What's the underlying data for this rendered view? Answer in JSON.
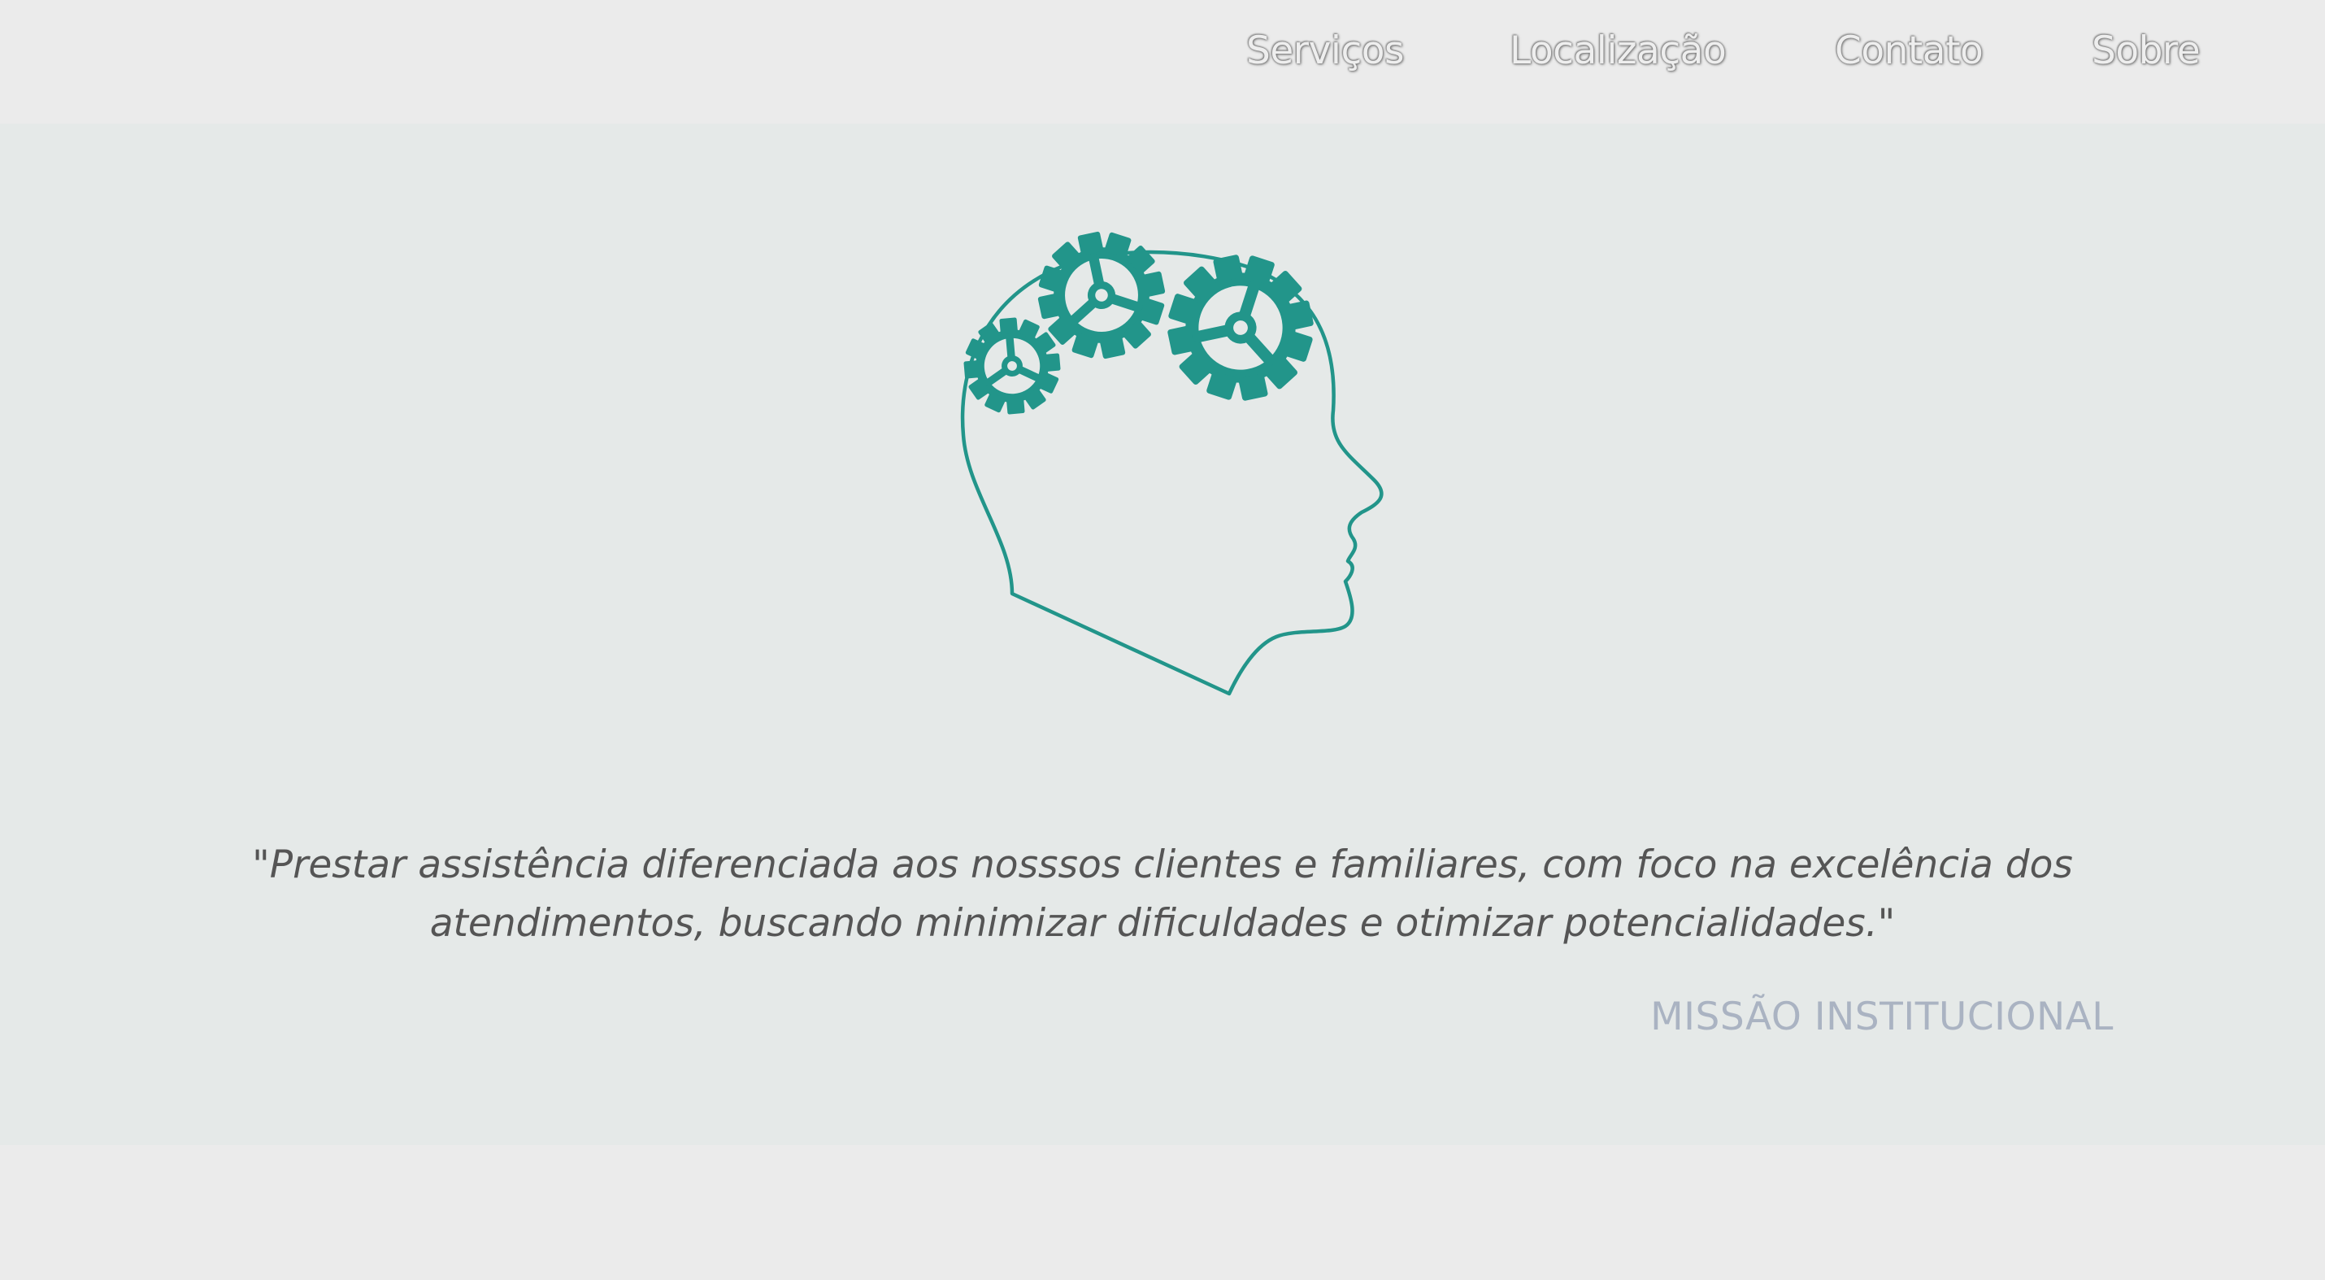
{
  "nav": {
    "items": [
      {
        "label": "Serviços"
      },
      {
        "label": "Localização"
      },
      {
        "label": "Contato"
      },
      {
        "label": "Sobre"
      }
    ]
  },
  "hero": {
    "logo_icon": "head-with-gears-icon",
    "quote_line1": "\"Prestar assistência diferenciada aos nosssos clientes e familiares, com foco na excelência dos",
    "quote_line2": "atendimentos, buscando minimizar dificuldades e otimizar potencialidades.\"",
    "mission_label": "MISSÃO INSTITUCIONAL"
  },
  "colors": {
    "accent": "#22958a",
    "page_bg": "#ebebeb",
    "hero_bg": "#e5e9e8",
    "quote_text": "#555555",
    "mission_text": "#aab3c2"
  }
}
